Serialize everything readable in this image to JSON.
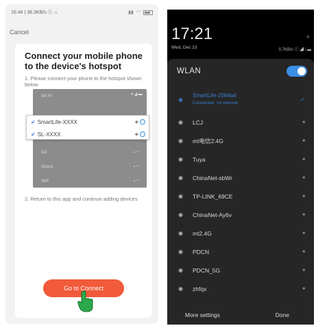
{
  "left": {
    "status": {
      "time": "16:46 | 38.3KB/s ⓒ ☼",
      "icons": "⁂ ⁞ ⌔"
    },
    "cancel": "Cancel",
    "title": "Connect your mobile phone to the device's hotspot",
    "step1": "1. Please connect your phone to the hotspot shown below",
    "mock": {
      "header": "WI-FI",
      "status_icons": "▾ ◢ ▬",
      "rows": [
        "5G",
        "Guest",
        "Wifi"
      ]
    },
    "popup": {
      "rows": [
        {
          "label": "SmartLife-XXXX"
        },
        {
          "label": "SL-XXXX"
        }
      ]
    },
    "step2": "2. Return to this app and continue adding devices",
    "go_button": "Go to Connect"
  },
  "right": {
    "clock": "17:21",
    "date": "Wed, Dec 23",
    "status": "0.7KB/s ⓒ ◢ ⁞ ▬",
    "search_icon": "⌕",
    "panel": {
      "title": "WLAN",
      "toggle_on": true,
      "networks": [
        {
          "name": "SmartLife-2064a4",
          "sub": "Connected, no internet",
          "active": true
        },
        {
          "name": "LCJ"
        },
        {
          "name": "mt电信2.4G"
        },
        {
          "name": "Tuya"
        },
        {
          "name": "ChinaNet-sbWr"
        },
        {
          "name": "TP-LINK_69CE"
        },
        {
          "name": "ChinaNet-Ay6v"
        },
        {
          "name": "mt2.4G"
        },
        {
          "name": "PDCN"
        },
        {
          "name": "PDCN_5G"
        },
        {
          "name": "zhfqx"
        }
      ]
    },
    "footer": {
      "more": "More settings",
      "done": "Done"
    }
  },
  "colors": {
    "accent": "#f15a3a",
    "blue": "#3a8ee6",
    "hand": "#2ba84a"
  }
}
